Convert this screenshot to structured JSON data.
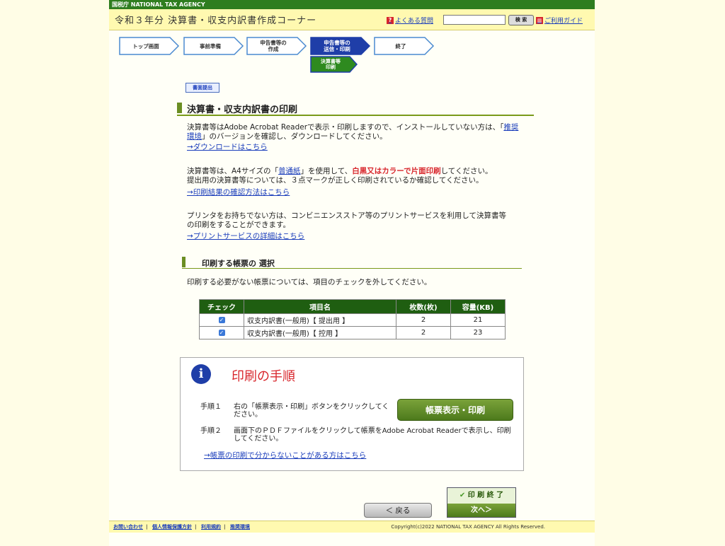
{
  "header": {
    "agency_label": "国税庁 NATIONAL TAX AGENCY",
    "site_title": "令和３年分 決算書・収支内訳書作成コーナー",
    "faq_link": "よくある質問",
    "search_button": "検 索",
    "guide_link": "ご利用ガイド"
  },
  "steps": {
    "top": "トップ画面",
    "prep": "事前準備",
    "create_1": "申告書等の",
    "create_2": "作成",
    "send_1": "申告書等の",
    "send_2": "送信・印刷",
    "end": "終了",
    "sub_1": "決算書等",
    "sub_2": "印刷"
  },
  "doc_submit_button": "書面提出",
  "section_title": "決算書・収支内訳書の印刷",
  "para1": {
    "text": "決算書等はAdobe Acrobat Readerで表示・印刷しますので、インストールしていない方は、「",
    "link": "推奨環境",
    "text2": "」のバージョンを確認し、ダウンロードしてください。",
    "download_link": "→ダウンロードはこちら"
  },
  "para2": {
    "text_a": "決算書等は、A4サイズの「",
    "paper_link": "普通紙",
    "text_b": "」を使用して、",
    "red": "白黒又はカラーで片面印刷",
    "text_c": "してください。",
    "line2": "提出用の決算書等については、３点マークが正しく印刷されているか確認してください。",
    "check_link": "→印刷結果の確認方法はこちら"
  },
  "para3": {
    "text": "プリンタをお持ちでない方は、コンビニエンスストア等のプリントサービスを利用して決算書等の印刷をすることができます。",
    "service_link": "→プリントサービスの詳細はこちら"
  },
  "sub_title": "印刷する帳票の 選択",
  "sub_instruction": "印刷する必要がない帳票については、項目のチェックを外してください。",
  "table": {
    "headers": [
      "チェック",
      "項目名",
      "枚数(枚)",
      "容量(KB)"
    ],
    "rows": [
      {
        "checked": true,
        "name": "収支内訳書(一般用)【 提出用 】",
        "pages": "2",
        "size": "21"
      },
      {
        "checked": true,
        "name": "収支内訳書(一般用)【 控用 】",
        "pages": "2",
        "size": "23"
      }
    ]
  },
  "procedure": {
    "title": "印刷の手順",
    "step1_label": "手順１",
    "step1_text": "右の「帳票表示・印刷」ボタンをクリックしてください。",
    "step2_label": "手順２",
    "step2_text": "画面下のＰＤＦファイルをクリックして帳票をAdobe Acrobat Readerで表示し、印刷してください。",
    "print_button": "帳票表示・印刷",
    "help_link": "→帳票の印刷で分からないことがある方はこちら"
  },
  "nav": {
    "back": "＜ 戻る",
    "done_top": "印 刷 終 了",
    "done_bottom": "次へ＞"
  },
  "footer": {
    "links": [
      "お問い合わせ",
      "個人情報保護方針",
      "利用規約",
      "推奨環境"
    ],
    "copyright": "Copyright(c)2022 NATIONAL TAX AGENCY All Rights Reserved."
  },
  "colors": {
    "agency_green": "#2e7d1f",
    "header_yellow": "#fff9b0",
    "active_step": "#1f3ea8",
    "accent_red": "#d8262c",
    "table_head": "#1f5e11"
  }
}
